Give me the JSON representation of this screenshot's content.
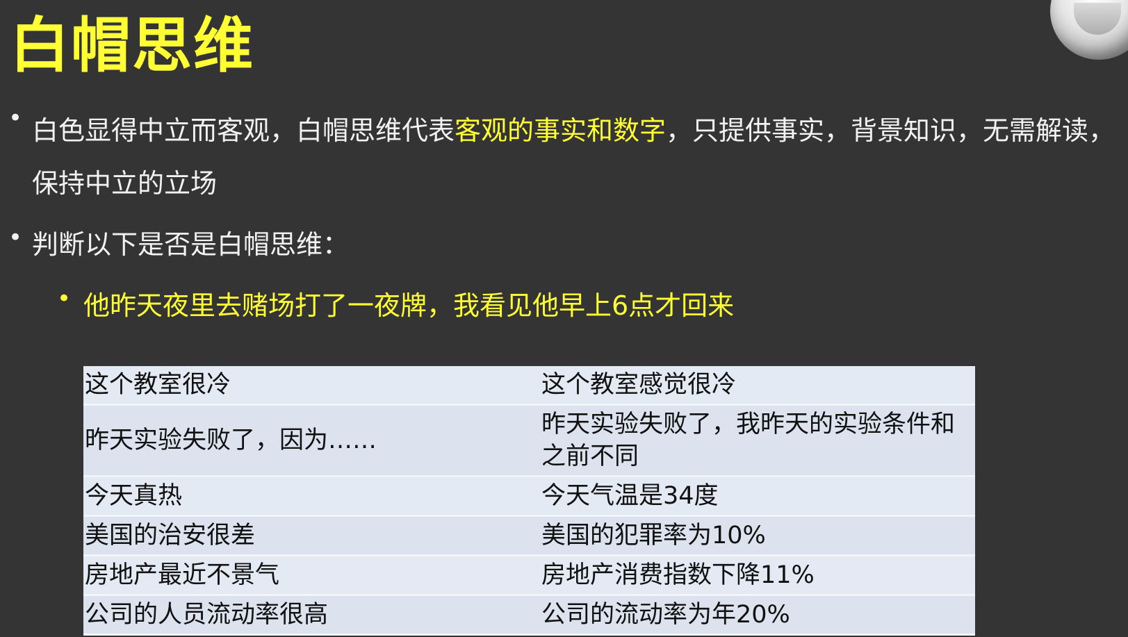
{
  "slide": {
    "title": "白帽思维",
    "bullets": [
      {
        "before": "白色显得中立而客观，白帽思维代表",
        "highlight": "客观的事实和数字",
        "after": "，只提供事实，背景知识，无需解读，保持中立的立场"
      },
      {
        "text": "判断以下是否是白帽思维："
      },
      {
        "text": "他昨天夜里去赌场打了一夜牌，我看见他早上6点才回来"
      }
    ],
    "table": {
      "rows": [
        {
          "left": "这个教室很冷",
          "right": "这个教室感觉很冷"
        },
        {
          "left": "昨天实验失败了，因为……",
          "right": "昨天实验失败了，我昨天的实验条件和之前不同"
        },
        {
          "left": "今天真热",
          "right": "今天气温是34度"
        },
        {
          "left": "美国的治安很差",
          "right": "美国的犯罪率为10%"
        },
        {
          "left": "房地产最近不景气",
          "right": "房地产消费指数下降11%"
        },
        {
          "left": "公司的人员流动率很高",
          "right": "公司的流动率为年20%"
        }
      ]
    }
  },
  "colors": {
    "background": "#343434",
    "accent": "#ffff33",
    "text": "#f2f2f2",
    "table_bg": "#dfe6f2"
  }
}
